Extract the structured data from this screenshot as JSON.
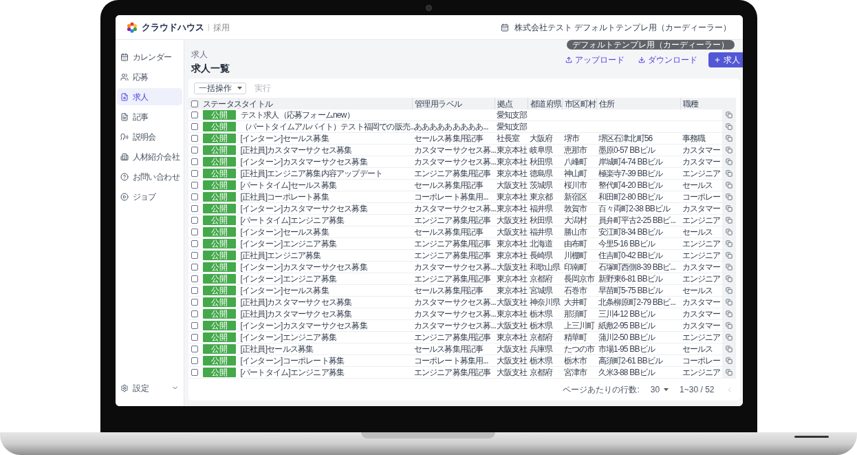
{
  "header": {
    "logo": "クラウドハウス",
    "logo_sub": "採用",
    "company": "株式会社テスト デフォルトテンプレ用（カーディーラー）",
    "tooltip": "デフォルトテンプレ用（カーディーラー）"
  },
  "sidebar": {
    "items": [
      {
        "label": "カレンダー",
        "selected": false
      },
      {
        "label": "応募",
        "selected": false
      },
      {
        "label": "求人",
        "selected": true
      },
      {
        "label": "記事",
        "selected": false
      },
      {
        "label": "説明会",
        "selected": false
      },
      {
        "label": "人材紹介会社",
        "selected": false
      },
      {
        "label": "お問い合わせ",
        "selected": false
      },
      {
        "label": "ジョブ",
        "selected": false
      }
    ],
    "settings": "設定"
  },
  "page": {
    "breadcrumb": "求人",
    "title": "求人一覧",
    "actions": [
      {
        "label": "アップロード",
        "kind": "upload"
      },
      {
        "label": "ダウンロード",
        "kind": "download"
      },
      {
        "label": "求人",
        "kind": "primary"
      }
    ]
  },
  "bulk": {
    "select": "一括操作",
    "run": {
      "label": "実行",
      "disabled": true
    }
  },
  "table": {
    "header_checked": false,
    "columns": [
      "ステータス",
      "タイトル",
      "管理用ラベル",
      "拠点",
      "都道府県",
      "市区町村",
      "住所",
      "職種"
    ],
    "rows": [
      {
        "checked": false,
        "status": "公開",
        "title": "テスト求人（応募フォームnew）",
        "base": "愛知支部"
      },
      {
        "checked": false,
        "status": "公開",
        "title": "（パートタイムアルバイト）テスト福岡での販売...",
        "label": "あああああああああ...",
        "base": "愛知支部"
      },
      {
        "checked": false,
        "status": "公開",
        "title": "[インターン]セールス募集",
        "label": "セールス募集用記事",
        "base": "社長室",
        "prefecture": "大阪府",
        "city": "堺市",
        "address": "堺区石津北町56",
        "job": "事務職"
      },
      {
        "checked": false,
        "status": "公開",
        "title": "[正社員]カスタマーサクセス募集",
        "label": "カスタマーサクセス募...",
        "base": "東京本社",
        "prefecture": "岐阜県",
        "city": "恵那市",
        "address": "墨原0-57 BBビル",
        "job": "カスタマー"
      },
      {
        "checked": false,
        "status": "公開",
        "title": "[インターン]カスタマーサクセス募集",
        "label": "カスタマーサクセス募...",
        "base": "東京本社",
        "prefecture": "秋田県",
        "city": "八峰町",
        "address": "岸城町4-74 BBビル",
        "job": "カスタマー"
      },
      {
        "checked": false,
        "status": "公開",
        "title": "[正社員]エンジニア募集内容アップデート",
        "label": "エンジニア募集用記事",
        "base": "東京本社",
        "prefecture": "徳島県",
        "city": "神山町",
        "address": "極楽寺7-39 BBビル",
        "job": "エンジニア"
      },
      {
        "checked": false,
        "status": "公開",
        "title": "[パートタイム]セールス募集",
        "label": "セールス募集用記事",
        "base": "大阪支社",
        "prefecture": "茨城県",
        "city": "桜川市",
        "address": "整代町4-20 BBビル",
        "job": "セールス"
      },
      {
        "checked": false,
        "status": "公開",
        "title": "[正社員]コーポレート募集",
        "label": "コーポレート募集用...",
        "base": "東京本社",
        "prefecture": "東京都",
        "city": "新宿区",
        "address": "和田町2-80 BBビル",
        "job": "コーポレー"
      },
      {
        "checked": false,
        "status": "公開",
        "title": "[インターン]カスタマーサクセス募集",
        "label": "カスタマーサクセス募...",
        "base": "東京本社",
        "prefecture": "福井県",
        "city": "敦賀市",
        "address": "百々両町2-38 BBビル",
        "job": "カスタマー"
      },
      {
        "checked": false,
        "status": "公開",
        "title": "[パートタイム]エンジニア募集",
        "label": "エンジニア募集用記事",
        "base": "大阪支社",
        "prefecture": "秋田県",
        "city": "大潟村",
        "address": "員弁町平古2-25 BBビ...",
        "job": "エンジニア"
      },
      {
        "checked": false,
        "status": "公開",
        "title": "[インターン]セールス募集",
        "label": "セールス募集用記事",
        "base": "大阪支社",
        "prefecture": "福井県",
        "city": "勝山市",
        "address": "安江町8-34 BBビル",
        "job": "セールス"
      },
      {
        "checked": false,
        "status": "公開",
        "title": "[インターン]エンジニア募集",
        "label": "エンジニア募集用記事",
        "base": "東京本社",
        "prefecture": "北海道",
        "city": "由布町",
        "address": "今里5-16 BBビル",
        "job": "エンジニア"
      },
      {
        "checked": false,
        "status": "公開",
        "title": "[正社員]エンジニア募集",
        "label": "エンジニア募集用記事",
        "base": "東京本社",
        "prefecture": "長崎県",
        "city": "川棚町",
        "address": "住吉町0-42 BBビル",
        "job": "エンジニア"
      },
      {
        "checked": false,
        "status": "公開",
        "title": "[インターン]カスタマーサクセス募集",
        "label": "カスタマーサクセス募...",
        "base": "大阪支社",
        "prefecture": "和歌山県",
        "city": "印南町",
        "address": "石塚町西側8-39 BBビ...",
        "job": "カスタマー"
      },
      {
        "checked": false,
        "status": "公開",
        "title": "[インターン]エンジニア募集",
        "label": "エンジニア募集用記事",
        "base": "東京本社",
        "prefecture": "京都府",
        "city": "長岡京市",
        "address": "新野東6-81 BBビル",
        "job": "エンジニア"
      },
      {
        "checked": false,
        "status": "公開",
        "title": "[インターン]セールス募集",
        "label": "セールス募集用記事",
        "base": "東京本社",
        "prefecture": "宮城県",
        "city": "石巻市",
        "address": "早苗町5-75 BBビル",
        "job": "セールス"
      },
      {
        "checked": false,
        "status": "公開",
        "title": "[正社員]カスタマーサクセス募集",
        "label": "カスタマーサクセス募...",
        "base": "大阪支社",
        "prefecture": "神奈川県",
        "city": "大井町",
        "address": "北条柳原町2-79 BBビ...",
        "job": "カスタマー"
      },
      {
        "checked": false,
        "status": "公開",
        "title": "[正社員]カスタマーサクセス募集",
        "label": "カスタマーサクセス募...",
        "base": "東京本社",
        "prefecture": "栃木県",
        "city": "那須町",
        "address": "三川4-12 BBビル",
        "job": "カスタマー"
      },
      {
        "checked": false,
        "status": "公開",
        "title": "[インターン]カスタマーサクセス募集",
        "label": "カスタマーサクセス募...",
        "base": "大阪支社",
        "prefecture": "栃木県",
        "city": "上三川町",
        "address": "紙敷2-95 BBビル",
        "job": "カスタマー"
      },
      {
        "checked": false,
        "status": "公開",
        "title": "[インターン]エンジニア募集",
        "label": "エンジニア募集用記事",
        "base": "東京本社",
        "prefecture": "京都府",
        "city": "精華町",
        "address": "蒲川2-50 BBビル",
        "job": "エンジニア"
      },
      {
        "checked": false,
        "status": "公開",
        "title": "[正社員]セールス募集",
        "label": "セールス募集用記事",
        "base": "大阪支社",
        "prefecture": "兵庫県",
        "city": "たつの市",
        "address": "市場1-95 BBビル",
        "job": "セールス"
      },
      {
        "checked": false,
        "status": "公開",
        "title": "[インターン]コーポレート募集",
        "label": "コーポレート募集用...",
        "base": "大阪支社",
        "prefecture": "栃木県",
        "city": "栃木市",
        "address": "高須町2-61 BBビル",
        "job": "コーポレー"
      },
      {
        "checked": false,
        "status": "公開",
        "title": "[パートタイム]エンジニア募集",
        "label": "エンジニア募集用記事",
        "base": "大阪支社",
        "prefecture": "京都府",
        "city": "宮津市",
        "address": "久米3-88 BBビル",
        "job": "エンジニア"
      }
    ]
  },
  "pagination": {
    "rows_label": "ページあたりの行数:",
    "rows_per_page": "30",
    "range": "1~30 / 52"
  }
}
